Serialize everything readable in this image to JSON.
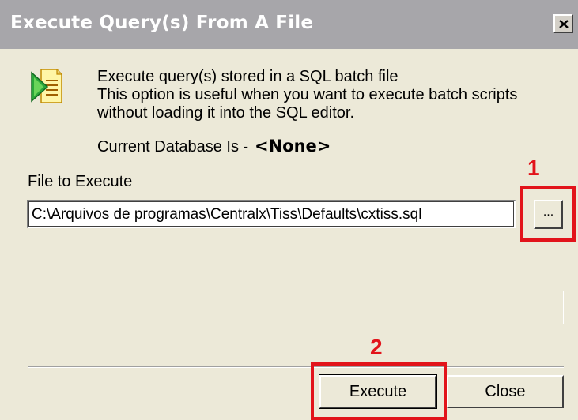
{
  "window": {
    "title": "Execute Query(s) From A File",
    "close_glyph": "×"
  },
  "description": {
    "line1": "Execute query(s) stored in a SQL batch file",
    "line2": "This option is useful when you want to execute batch scripts",
    "line3": "without loading it into the SQL editor."
  },
  "database": {
    "label": "Current Database Is -",
    "value": "<None>"
  },
  "file": {
    "label": "File to Execute",
    "value": "C:\\Arquivos de programas\\Centralx\\Tiss\\Defaults\\cxtiss.sql",
    "browse_label": "..."
  },
  "progress": {
    "value": 0
  },
  "buttons": {
    "execute_label": "Execute",
    "close_label": "Close"
  },
  "annotations": {
    "marker1": "1",
    "marker2": "2",
    "color": "#e2141b"
  },
  "icons": {
    "app": "sql-batch-file-icon",
    "close": "close-icon"
  }
}
